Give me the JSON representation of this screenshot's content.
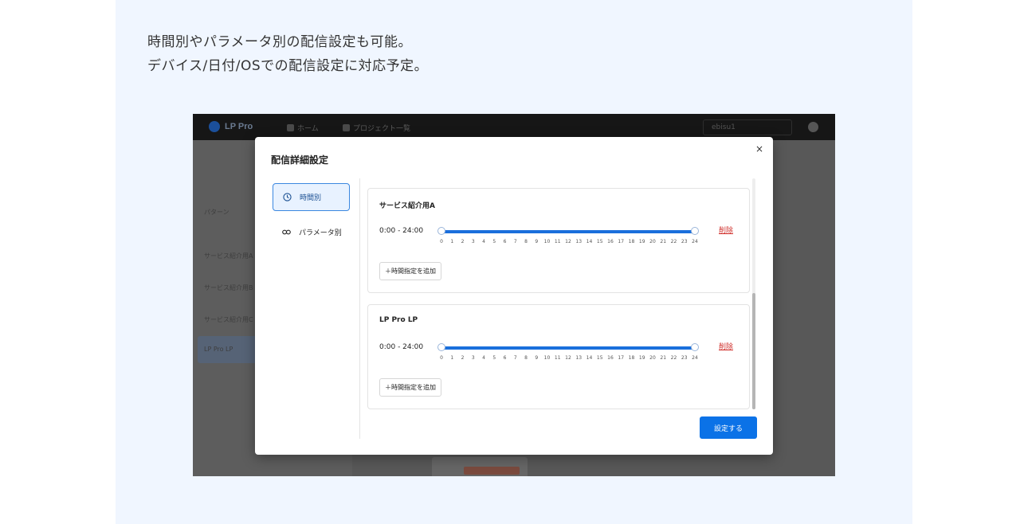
{
  "caption": {
    "line1": "時間別やパラメータ別の配信設定も可能。",
    "line2": "デバイス/日付/OSでの配信設定に対応予定。"
  },
  "app": {
    "logo_text": "LP Pro",
    "nav": [
      "ホーム",
      "プロジェクト一覧"
    ],
    "account": "ebisu1",
    "background_rows": [
      "サービス紹介用A",
      "サービス紹介用B",
      "サービス紹介用C",
      "LP Pro LP"
    ],
    "background_label": "パターン"
  },
  "modal": {
    "title": "配信詳細設定",
    "close_label": "×",
    "nav": [
      {
        "label": "時間別",
        "icon": "clock-icon",
        "active": true
      },
      {
        "label": "パラメータ別",
        "icon": "link-icon",
        "active": false
      }
    ],
    "cards": [
      {
        "title": "サービス紹介用A",
        "range": "0:00 - 24:00",
        "delete_label": "削除",
        "add_label": "＋時間指定を追加",
        "range_start": 0,
        "range_end": 24
      },
      {
        "title": "LP Pro LP",
        "range": "0:00 - 24:00",
        "delete_label": "削除",
        "add_label": "＋時間指定を追加",
        "range_start": 0,
        "range_end": 24
      }
    ],
    "hour_ticks": [
      "0",
      "1",
      "2",
      "3",
      "4",
      "5",
      "6",
      "7",
      "8",
      "9",
      "10",
      "11",
      "12",
      "13",
      "14",
      "15",
      "16",
      "17",
      "18",
      "19",
      "20",
      "21",
      "22",
      "23",
      "24"
    ],
    "submit_label": "設定する"
  },
  "colors": {
    "accent": "#0b72e7",
    "danger": "#d0312d",
    "panel_bg": "#f0f6ff"
  }
}
